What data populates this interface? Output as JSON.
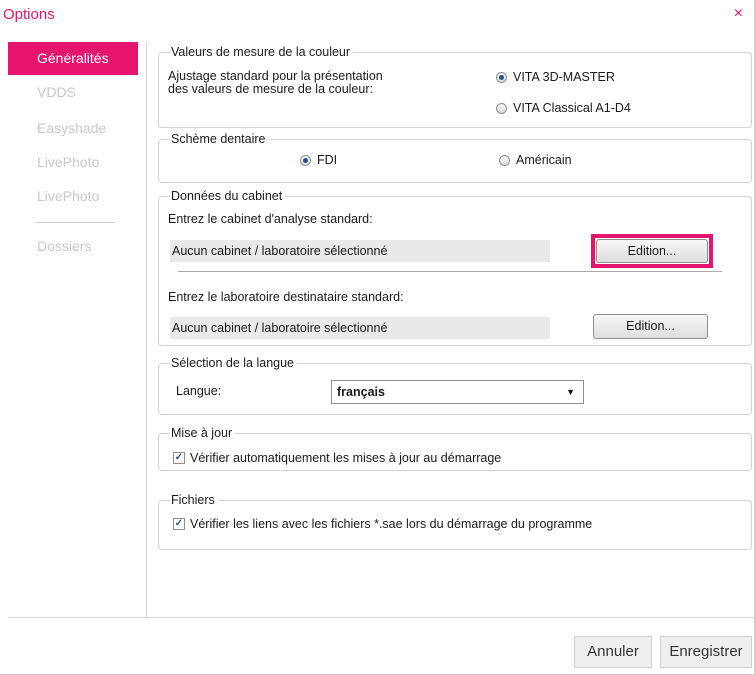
{
  "window": {
    "title": "Options",
    "close_icon": "×"
  },
  "colors": {
    "accent": "#e5146e"
  },
  "sidebar": {
    "items": [
      {
        "label": "Généralités",
        "active": true
      },
      {
        "label": "VDDS"
      },
      {
        "label": "Easyshade"
      },
      {
        "label": "LivePhoto"
      },
      {
        "label": "LivePhoto"
      },
      {
        "label": "Dossiers"
      }
    ]
  },
  "color_measure": {
    "legend": "Valeurs de mesure de la couleur",
    "description": "Ajustage standard pour la présentation\ndes valeurs de mesure de la couleur:",
    "options": [
      "VITA 3D-MASTER",
      "VITA Classical A1-D4"
    ],
    "selected": "VITA 3D-MASTER"
  },
  "dental_scheme": {
    "legend": "Schème dentaire",
    "options": [
      "FDI",
      "Américain"
    ],
    "selected": "FDI"
  },
  "cabinet": {
    "legend": "Données du cabinet",
    "analysis_prompt": "Entrez le cabinet d'analyse standard:",
    "analysis_value": "Aucun cabinet / laboratoire sélectionné",
    "lab_prompt": "Entrez le laboratoire destinataire standard:",
    "lab_value": "Aucun cabinet / laboratoire sélectionné",
    "edit_label": "Edition..."
  },
  "language": {
    "legend": "Sélection de la langue",
    "label": "Langue:",
    "value": "français"
  },
  "update": {
    "legend": "Mise à jour",
    "checkbox_label": "Vérifier automatiquement les mises à jour au démarrage",
    "checked": true
  },
  "files": {
    "legend": "Fichiers",
    "checkbox_label": "Vérifier les liens avec les fichiers *.sae lors du démarrage du programme",
    "checked": true
  },
  "footer": {
    "cancel_label": "Annuler",
    "save_label": "Enregistrer"
  }
}
